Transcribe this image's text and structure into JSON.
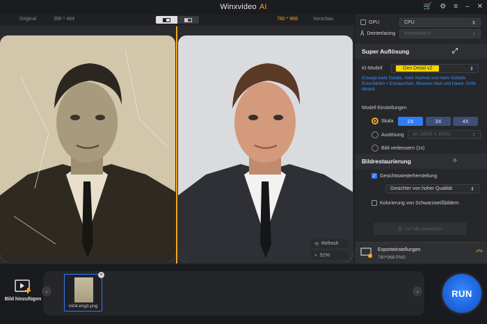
{
  "app": {
    "title": "Winxvideo",
    "title_suffix": "AI"
  },
  "compare": {
    "original_label": "Original",
    "original_dims": "390 * 484",
    "output_dims": "780 * 968",
    "preview_label": "Vorschau"
  },
  "preview": {
    "refresh_label": "Refresh",
    "zoom_label": "51%"
  },
  "settings": {
    "gpu_label": "GPU",
    "gpu_value": "CPU",
    "deinterlacing_label": "Deinterlacing",
    "deinterlacing_value": "Automatisch"
  },
  "super_res": {
    "heading": "Super Auflösung",
    "model_label": "KI-Modell",
    "model_value": "Gen Detail v2",
    "description": "Erzeugt mehr Details, mehr Klarheit und mehr Schärfe. Entschärfen + Entrauschen. Bessere Haut und Haare. GAN-Modell.",
    "settings_label": "Modell Einstellungen",
    "scale_label": "Skala",
    "scale_options": [
      "2X",
      "3X",
      "4X"
    ],
    "scale_selected": "2X",
    "resolution_label": "Auslösung",
    "resolution_value": "4K (3008 X 4096)",
    "enhance_label": "Bild verbessern (1x)"
  },
  "restoration": {
    "heading": "Bildrestaurierung",
    "face_label": "Gesichtswiederherstellung",
    "face_checked": true,
    "face_mode": "Gesichter von hoher Qualität",
    "colorize_label": "Kolorierung von Schwarzweißbildern",
    "colorize_checked": false,
    "apply_all_label": "Auf alle anwenden"
  },
  "export": {
    "title": "Exporteinstellungen",
    "subtitle": "780*968  PNG"
  },
  "bottom": {
    "add_label": "Bild hinzufügen",
    "file_name": "m04-img3.png",
    "run_label": "RUN"
  },
  "colors": {
    "accent": "#f5a623",
    "primary": "#2f7cf6",
    "model_pill": "#f5d400"
  }
}
